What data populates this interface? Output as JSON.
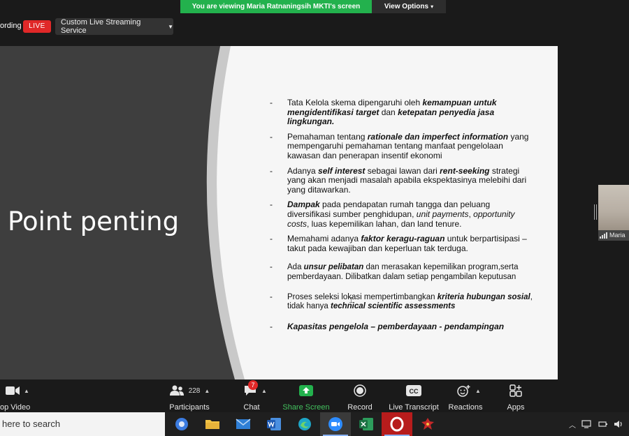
{
  "banner": {
    "viewing_text": "You are viewing Maria Ratnaningsih MKTI's screen",
    "view_options": "View Options"
  },
  "topbar": {
    "recording_text": "ording",
    "live_label": "LIVE",
    "stream_service": "Custom Live Streaming Service"
  },
  "slide": {
    "title": "Point penting",
    "bullets": [
      {
        "segments": [
          {
            "t": "Tata Kelola skema dipengaruhi oleh "
          },
          {
            "t": "kemampuan untuk mengidentifikasi target",
            "b": true
          },
          {
            "t": " dan "
          },
          {
            "t": "ketepatan penyedia jasa lingkungan.",
            "b": true
          }
        ]
      },
      {
        "segments": [
          {
            "t": "Pemahaman tentang "
          },
          {
            "t": "rationale dan imperfect information",
            "b": true
          },
          {
            "t": " yang mempengaruhi pemahaman tentang manfaat pengelolaan kawasan dan penerapan insentif ekonomi"
          }
        ]
      },
      {
        "segments": [
          {
            "t": "Adanya "
          },
          {
            "t": "self interest",
            "b": true
          },
          {
            "t": " sebagai lawan dari "
          },
          {
            "t": "rent-seeking",
            "b": true
          },
          {
            "t": " strategi yang akan menjadi masalah apabila ekspektasinya melebihi dari yang ditawarkan."
          }
        ]
      },
      {
        "segments": [
          {
            "t": "Dampak",
            "b": true
          },
          {
            "t": " pada pendapatan rumah tangga dan peluang diversifikasi sumber penghidupan, "
          },
          {
            "t": "unit payments",
            "i": true
          },
          {
            "t": ", "
          },
          {
            "t": "opportunity costs",
            "i": true
          },
          {
            "t": ", luas kepemilikan lahan, dan land tenure."
          }
        ]
      },
      {
        "segments": [
          {
            "t": "Memahami adanya "
          },
          {
            "t": "faktor keragu-raguan",
            "b": true
          },
          {
            "t": " untuk berpartisipasi – takut pada kewajiban dan keperluan tak terduga."
          }
        ]
      },
      {
        "segments": [
          {
            "t": "Ada "
          },
          {
            "t": "unsur pelibatan",
            "b": true
          },
          {
            "t": " dan merasakan kepemilikan program,serta pemberdayaan. Dilibatkan dalam setiap pengambilan keputusan"
          }
        ],
        "small": true
      },
      {
        "segments": [
          {
            "t": "Proses seleksi lokasi mempertimbangkan "
          },
          {
            "t": "kriteria hubungan sosial",
            "b": true
          },
          {
            "t": ", tidak hanya "
          },
          {
            "t": "technical scientific assessments",
            "b": true
          }
        ],
        "small": true
      },
      {
        "segments": [
          {
            "t": "Kapasitas pengelola – pemberdayaan - pendampingan",
            "b": true
          }
        ]
      }
    ]
  },
  "participant_thumb": {
    "name": "Maria"
  },
  "controls": {
    "video_label": "op Video",
    "participants_label": "Participants",
    "participants_count": "228",
    "chat_label": "Chat",
    "chat_badge": "7",
    "share_label": "Share Screen",
    "record_label": "Record",
    "transcript_label": "Live Transcript",
    "cc_text": "CC",
    "reactions_label": "Reactions",
    "apps_label": "Apps"
  },
  "taskbar": {
    "search_placeholder": "here to search",
    "apps": [
      "chrome-like",
      "file-explorer",
      "mail",
      "word",
      "edge",
      "zoom",
      "excel",
      "opera",
      "game"
    ]
  },
  "colors": {
    "live_red": "#e02828",
    "share_green": "#23b14d",
    "slide_bg": "#f6f6f6",
    "slide_dark": "#3e3e3e"
  }
}
